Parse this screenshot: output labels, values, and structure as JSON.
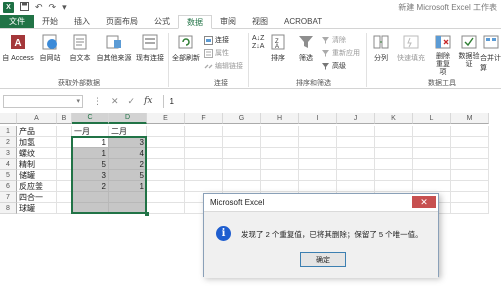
{
  "titlebar": {
    "app_icon": "X",
    "title": "新建 Microsoft Excel 工作表"
  },
  "tabs": [
    "文件",
    "开始",
    "插入",
    "页面布局",
    "公式",
    "数据",
    "审阅",
    "视图",
    "ACROBAT"
  ],
  "ribbon": {
    "get_external": {
      "label": "获取外部数据",
      "buttons": [
        "自 Access",
        "自网站",
        "自文本",
        "自其他来源",
        "现有连接"
      ]
    },
    "connections": {
      "label": "连接",
      "refresh_all": "全部刷新",
      "items": [
        "连接",
        "属性",
        "编辑链接"
      ]
    },
    "sort_filter": {
      "label": "排序和筛选",
      "sort": "排序",
      "filter": "筛选",
      "items": [
        "清除",
        "重新应用",
        "高级"
      ]
    },
    "data_tools": {
      "label": "数据工具",
      "buttons": [
        "分列",
        "快速填充",
        "删除重复项",
        "数据验证",
        "合并计算"
      ]
    }
  },
  "formula_bar": {
    "name_box": "",
    "fx": "fx",
    "value": "1",
    "cancel": "✕",
    "enter": "✓"
  },
  "sheet": {
    "columns": [
      "A",
      "B",
      "C",
      "D",
      "E",
      "F",
      "G",
      "H",
      "I",
      "J",
      "K",
      "L",
      "M"
    ],
    "rows": [
      "1",
      "2",
      "3",
      "4",
      "5",
      "6",
      "7",
      "8"
    ],
    "cells": [
      [
        "产品",
        "",
        "一月",
        "二月"
      ],
      [
        "加氢",
        "",
        "1",
        "3"
      ],
      [
        "螺纹",
        "",
        "1",
        "4"
      ],
      [
        "精制",
        "",
        "5",
        "2"
      ],
      [
        "储罐",
        "",
        "3",
        "5"
      ],
      [
        "反应釜",
        "",
        "2",
        "1"
      ],
      [
        "四合一",
        "",
        "",
        ""
      ],
      [
        "球罐",
        "",
        "",
        ""
      ]
    ]
  },
  "dialog": {
    "title": "Microsoft Excel",
    "close": "✕",
    "icon": "i",
    "message": "发现了 2 个重复值，已将其删除；保留了 5 个唯一值。",
    "ok": "确定"
  },
  "colors": {
    "accent": "#217346",
    "dialog_icon": "#1f5ecf"
  }
}
